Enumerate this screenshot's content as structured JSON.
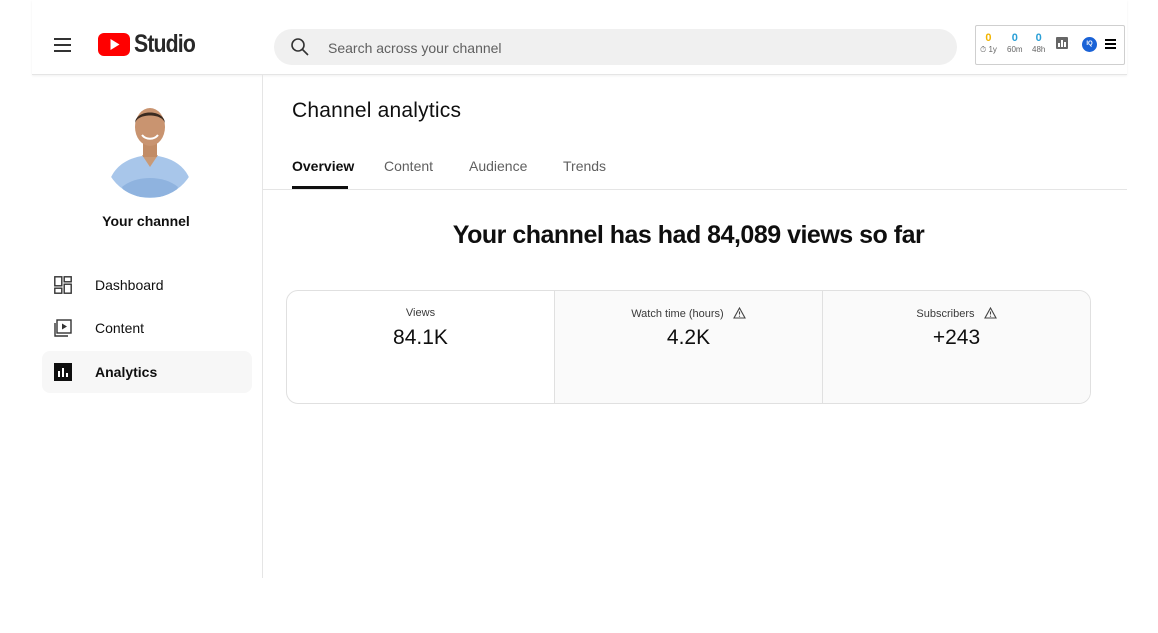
{
  "header": {
    "logo_text": "Studio",
    "search_placeholder": "Search across your channel",
    "extension": {
      "stats": [
        {
          "value": "0",
          "label": "1y",
          "color": "#f2b400"
        },
        {
          "value": "0",
          "label": "60m",
          "color": "#2a9fd6"
        },
        {
          "value": "0",
          "label": "48h",
          "color": "#2a9fd6"
        }
      ],
      "badge_text": "IQ"
    }
  },
  "sidebar": {
    "channel_label": "Your channel",
    "items": [
      {
        "label": "Dashboard",
        "icon": "dashboard-icon"
      },
      {
        "label": "Content",
        "icon": "content-icon"
      },
      {
        "label": "Analytics",
        "icon": "analytics-icon",
        "active": true
      }
    ]
  },
  "main": {
    "title": "Channel analytics",
    "tabs": [
      {
        "label": "Overview",
        "active": true
      },
      {
        "label": "Content"
      },
      {
        "label": "Audience"
      },
      {
        "label": "Trends"
      }
    ],
    "headline": "Your channel has had 84,089 views so far",
    "metrics": [
      {
        "label": "Views",
        "value": "84.1K",
        "warning": false
      },
      {
        "label": "Watch time (hours)",
        "value": "4.2K",
        "warning": true
      },
      {
        "label": "Subscribers",
        "value": "+243",
        "warning": true
      }
    ]
  },
  "colors": {
    "brand_red": "#ff0000",
    "text_primary": "#0f0f0f",
    "text_secondary": "#606060"
  }
}
